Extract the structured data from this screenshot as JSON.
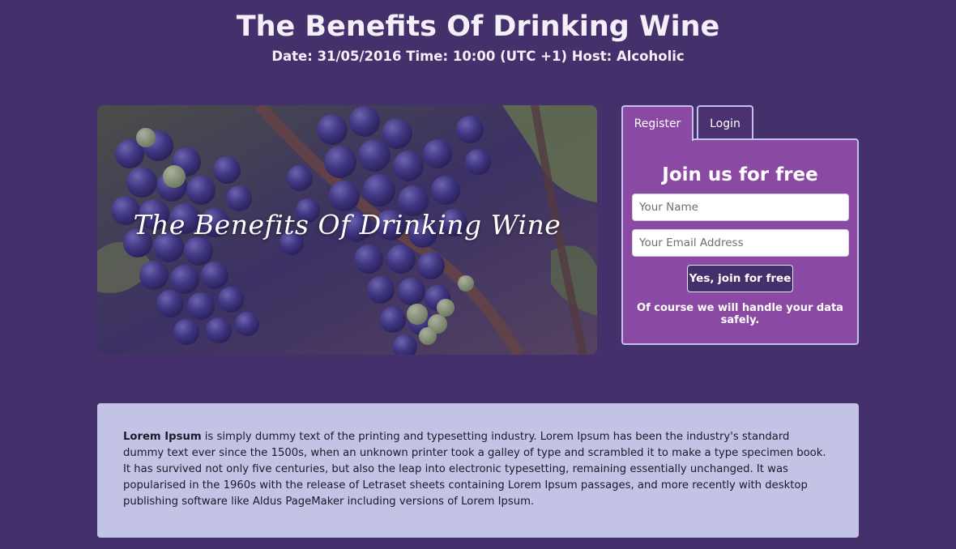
{
  "header": {
    "title": "The Benefits Of Drinking Wine",
    "subtitle": "Date: 31/05/2016 Time: 10:00 (UTC +1) Host: Alcoholic"
  },
  "hero": {
    "title": "The Benefits Of Drinking Wine"
  },
  "tabs": [
    {
      "label": "Register",
      "active": true
    },
    {
      "label": "Login",
      "active": false
    }
  ],
  "form": {
    "title": "Join us for free",
    "name_placeholder": "Your Name",
    "email_placeholder": "Your Email Address",
    "submit_label": "Yes, join for free",
    "note": "Of course we will handle your data safely."
  },
  "content": {
    "lead": "Lorem Ipsum",
    "body": " is simply dummy text of the printing and typesetting industry. Lorem Ipsum has been the industry's standard dummy text ever since the 1500s, when an unknown printer took a galley of type and scrambled it to make a type specimen book. It has survived not only five centuries, but also the leap into electronic typesetting, remaining essentially unchanged. It was popularised in the 1960s with the release of Letraset sheets containing Lorem Ipsum passages, and more recently with desktop publishing software like Aldus PageMaker including versions of Lorem Ipsum."
  },
  "colors": {
    "page_bg": "#44306a",
    "form_bg": "#8a4aa3",
    "content_bg": "#c3c3e6",
    "button_bg": "#44306a"
  }
}
